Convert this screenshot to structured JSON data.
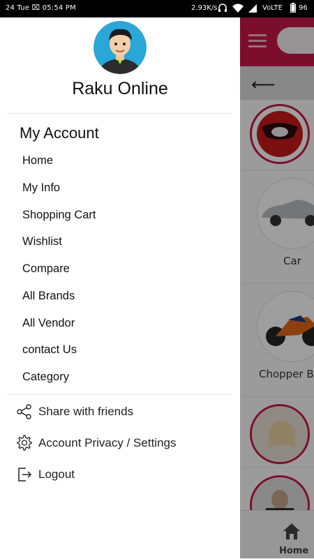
{
  "status_bar": {
    "time": "24 Tue ⌧ 05:54 PM",
    "network_speed": "2.93K/s",
    "network_type": "VoLTE",
    "battery": "96"
  },
  "drawer": {
    "username": "Raku Online",
    "section_title": "My Account",
    "menu_items": [
      {
        "label": "Home"
      },
      {
        "label": "My Info"
      },
      {
        "label": "Shopping Cart"
      },
      {
        "label": "Wishlist"
      },
      {
        "label": "Compare"
      },
      {
        "label": "All Brands"
      },
      {
        "label": "All Vendor"
      },
      {
        "label": "contact Us"
      },
      {
        "label": "Category"
      }
    ],
    "footer_items": [
      {
        "label": "Share with friends",
        "icon": "share-icon"
      },
      {
        "label": "Account Privacy / Settings",
        "icon": "gear-icon"
      },
      {
        "label": "Logout",
        "icon": "logout-icon"
      }
    ]
  },
  "background_app": {
    "categories": [
      {
        "label": "Car"
      },
      {
        "label": "Chopper Bi"
      }
    ],
    "bottom_nav": {
      "home_label": "Home"
    }
  },
  "colors": {
    "accent": "#c8174a",
    "overlay": "rgba(0,0,0,0.38)"
  }
}
